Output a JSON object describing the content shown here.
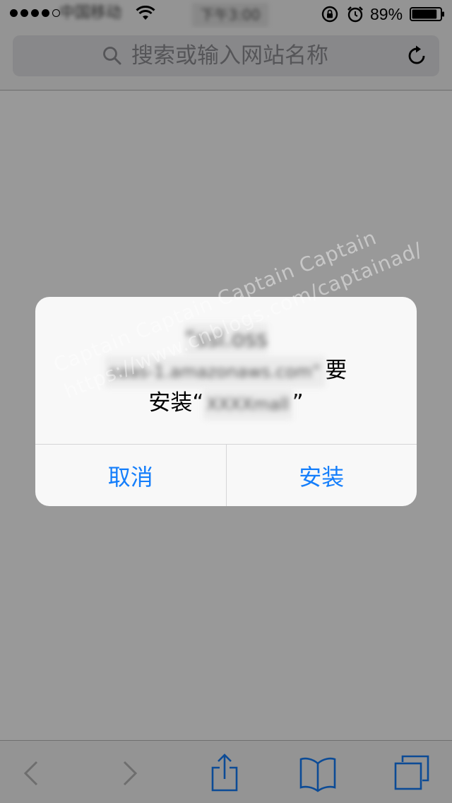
{
  "status_bar": {
    "carrier": "中国移动",
    "time": "下午3:00",
    "battery_percent": "89%",
    "battery_level": 0.89
  },
  "address_bar": {
    "placeholder": "搜索或输入网站名称"
  },
  "alert": {
    "domain_line1": "“ssl.oss",
    "domain_line2": "saas-1.amazonaws.com”",
    "verb": "要",
    "install_prefix": "安装“",
    "app_name": "XXXXmall",
    "install_suffix": "”",
    "cancel_label": "取消",
    "install_label": "安装"
  },
  "watermark": {
    "line1": "Captain  Captain  Captain  Captain",
    "line2": "https://www.cnblogs.com/captainad/"
  },
  "colors": {
    "accent": "#147efb",
    "overlay": "rgba(0,0,0,0.4)"
  }
}
